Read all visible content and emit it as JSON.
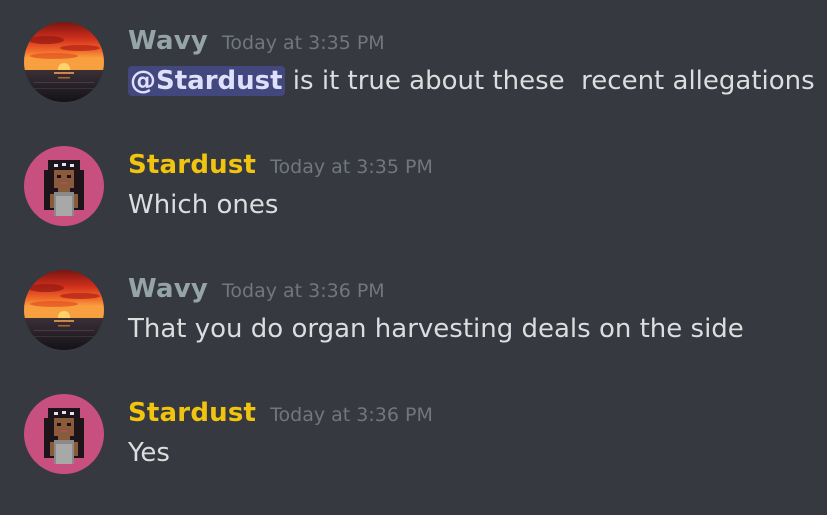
{
  "colors": {
    "background": "#36393f",
    "wavy_name": "#95a5a6",
    "stardust_name": "#f1c40f",
    "timestamp": "#72767d",
    "text": "#dcddde",
    "mention_bg": "#5865f2"
  },
  "messages": [
    {
      "author": "Wavy",
      "timestamp": "Today at 3:35 PM",
      "mention": "@Stardust",
      "text": " is it true about these  recent allegations",
      "avatar": "sunset-avatar-icon"
    },
    {
      "author": "Stardust",
      "timestamp": "Today at 3:35 PM",
      "text": "Which ones",
      "avatar": "pixel-girl-avatar-icon"
    },
    {
      "author": "Wavy",
      "timestamp": "Today at 3:36 PM",
      "text": "That you do organ harvesting deals on the side",
      "avatar": "sunset-avatar-icon"
    },
    {
      "author": "Stardust",
      "timestamp": "Today at 3:36 PM",
      "text": "Yes",
      "avatar": "pixel-girl-avatar-icon"
    }
  ]
}
